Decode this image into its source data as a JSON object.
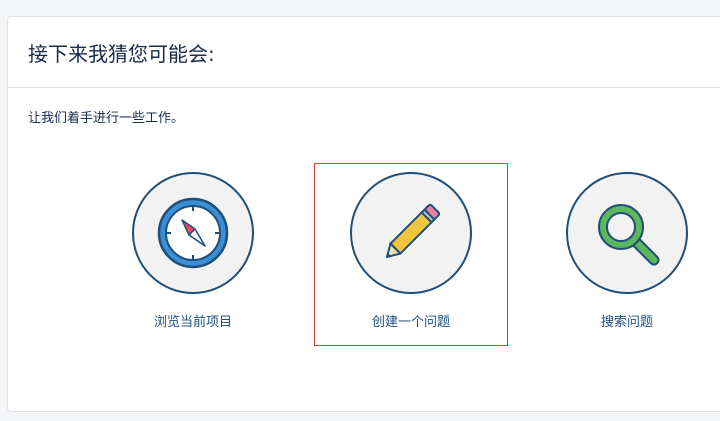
{
  "heading": "接下来我猜您可能会:",
  "intro": "让我们着手进行一些工作。",
  "options": [
    {
      "label": "浏览当前项目",
      "icon": "compass-icon",
      "selected": false
    },
    {
      "label": "创建一个问题",
      "icon": "pencil-icon",
      "selected": true
    },
    {
      "label": "搜索问题",
      "icon": "magnifier-icon",
      "selected": false
    }
  ],
  "colors": {
    "link": "#205081",
    "heading": "#172b4d",
    "circle_border": "#1f4e79",
    "circle_fill": "#f2f2f2",
    "selected_border": "#d04437",
    "compass_blue": "#3b8fd4",
    "compass_needle": "#e84a5f",
    "pencil_body": "#f3c63f",
    "pencil_eraser": "#e7839d",
    "magnifier_green": "#5cb85c"
  }
}
